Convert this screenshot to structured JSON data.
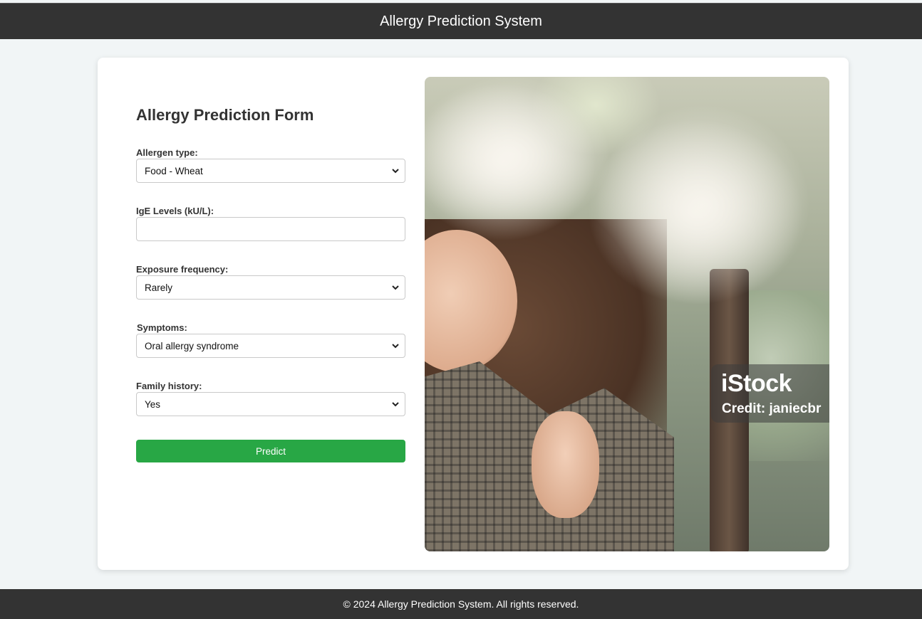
{
  "header": {
    "title": "Allergy Prediction System"
  },
  "form": {
    "title": "Allergy Prediction Form",
    "fields": [
      {
        "label": "Allergen type:",
        "value": "Food - Wheat"
      },
      {
        "label": "IgE Levels (kU/L):",
        "value": ""
      },
      {
        "label": "Exposure frequency:",
        "value": "Rarely"
      },
      {
        "label": "Symptoms:",
        "value": "Oral allergy syndrome"
      },
      {
        "label": "Family history:",
        "value": "Yes"
      }
    ],
    "submit_label": "Predict"
  },
  "image": {
    "watermark_logo": "iStock",
    "watermark_credit": "Credit: janiecbr"
  },
  "footer": {
    "text": "© 2024 Allergy Prediction System. All rights reserved."
  },
  "colors": {
    "header_bg": "#333333",
    "page_bg": "#f1f5f6",
    "submit_bg": "#28a745"
  },
  "icons": {
    "select_arrow": "chevron-down-icon"
  }
}
